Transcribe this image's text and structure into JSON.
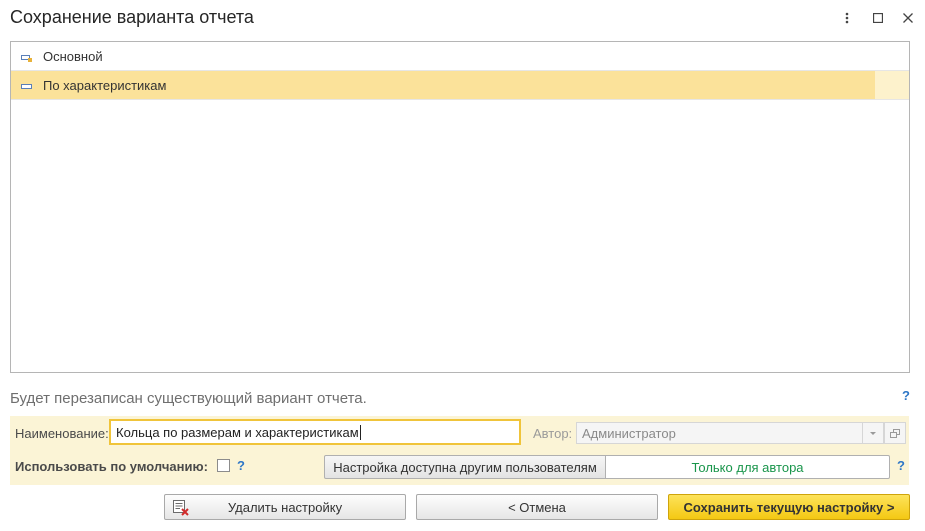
{
  "window": {
    "title": "Сохранение варианта отчета"
  },
  "variants": [
    {
      "label": "Основной",
      "icon": "report-variant-icon",
      "selected": false
    },
    {
      "label": "По характеристикам",
      "icon": "report-variant-icon",
      "selected": true
    }
  ],
  "message": "Будет перезаписан существующий вариант отчета.",
  "form": {
    "name_label": "Наименование:",
    "name_value": "Кольца по размерам и характеристикам",
    "author_label": "Автор:",
    "author_value": "Администратор",
    "default_label": "Использовать по умолчанию:",
    "default_checked": false,
    "availability_options": [
      "Настройка доступна другим пользователям",
      "Только для автора"
    ],
    "availability_selected": "Только для автора",
    "help_mark": "?"
  },
  "buttons": {
    "delete": "Удалить настройку",
    "cancel": "< Отмена",
    "save": "Сохранить текущую настройку >"
  },
  "colors": {
    "selection": "#fbe29a",
    "band": "#fbf4d6",
    "primary": "#f4c813",
    "help": "#2e77c7",
    "author_only": "#19954b"
  }
}
